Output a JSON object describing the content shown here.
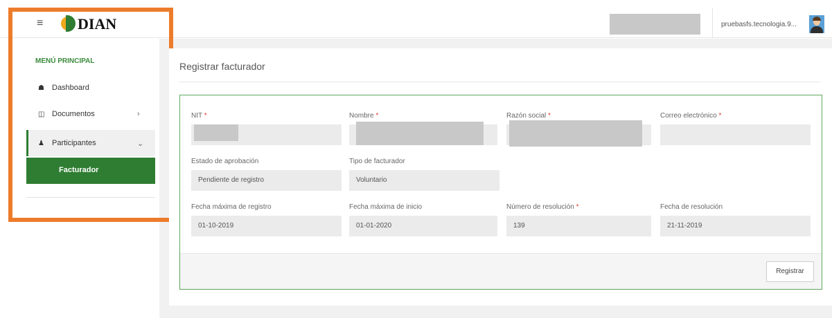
{
  "header": {
    "menu_icon": "hamburger-icon",
    "logo_text": "DIAN",
    "user_name": "pruebasfs.tecnologia.9...",
    "avatar_icon": "user-avatar"
  },
  "sidebar": {
    "title": "MENÚ PRINCIPAL",
    "items": [
      {
        "label": "Dashboard",
        "icon": "home-icon"
      },
      {
        "label": "Documentos",
        "icon": "lock-icon",
        "chevron": "›"
      },
      {
        "label": "Participantes",
        "icon": "users-icon",
        "chevron": "⌄"
      }
    ],
    "sub_item": "Facturador"
  },
  "page": {
    "title": "Registrar facturador"
  },
  "form": {
    "nit_label": "NIT",
    "nombre_label": "Nombre",
    "razon_label": "Razón social",
    "correo_label": "Correo electrónico",
    "required_mark": "*",
    "estado_label": "Estado de aprobación",
    "estado_value": "Pendiente de registro",
    "tipo_label": "Tipo de facturador",
    "tipo_value": "Voluntario",
    "fecha_reg_label": "Fecha máxima de registro",
    "fecha_reg_value": "01-10-2019",
    "fecha_ini_label": "Fecha máxima de inicio",
    "fecha_ini_value": "01-01-2020",
    "num_res_label": "Número de resolución",
    "num_res_value": "139",
    "fecha_res_label": "Fecha de resolución",
    "fecha_res_value": "21-11-2019",
    "submit_label": "Registrar"
  },
  "colors": {
    "accent_green": "#2e7d32",
    "highlight_orange": "#ec7c2b",
    "required_red": "#e53935"
  }
}
